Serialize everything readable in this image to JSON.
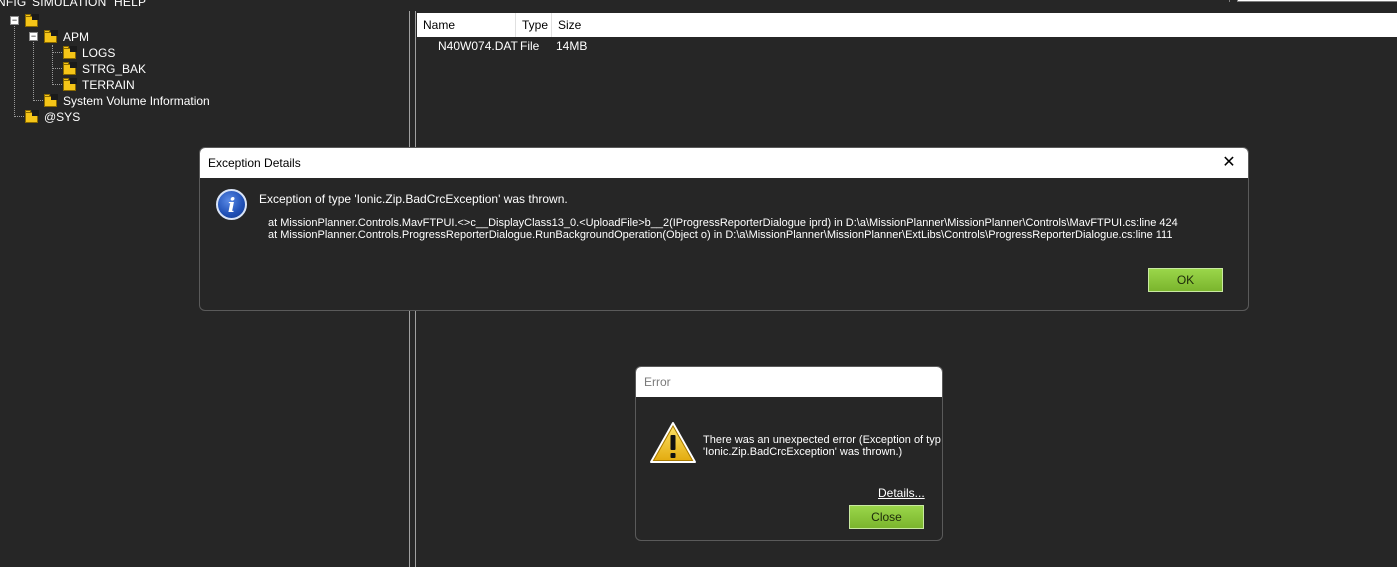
{
  "menubar": {
    "items": [
      "NFIG",
      "SIMULATION",
      "HELP"
    ]
  },
  "tree": {
    "nodes": {
      "root": "",
      "apm": "APM",
      "logs": "LOGS",
      "strg_bak": "STRG_BAK",
      "terrain": "TERRAIN",
      "svi": "System Volume Information",
      "sys": "@SYS"
    },
    "expander_minus": "−"
  },
  "file_list": {
    "columns": [
      "Name",
      "Type",
      "Size"
    ],
    "rows": [
      {
        "name": "N40W074.DAT",
        "type": "File",
        "size": "14MB"
      }
    ]
  },
  "exception_dialog": {
    "title": "Exception Details",
    "close_glyph": "✕",
    "icon_glyph": "i",
    "message": "Exception of type 'Ionic.Zip.BadCrcException' was thrown.",
    "trace_line1": "at MissionPlanner.Controls.MavFTPUI.<>c__DisplayClass13_0.<UploadFile>b__2(IProgressReporterDialogue iprd)  in  D:\\a\\MissionPlanner\\MissionPlanner\\Controls\\MavFTPUI.cs:line  424",
    "trace_line2": "at MissionPlanner.Controls.ProgressReporterDialogue.RunBackgroundOperation(Object o) in D:\\a\\MissionPlanner\\MissionPlanner\\ExtLibs\\Controls\\ProgressReporterDialogue.cs:line 111",
    "ok_label": "OK"
  },
  "error_dialog": {
    "title": "Error",
    "message_line1": "There was an unexpected error (Exception of typ",
    "message_line2": "'Ionic.Zip.BadCrcException' was thrown.)",
    "details_label": "Details...",
    "close_label": "Close"
  },
  "colors": {
    "background": "#262626",
    "button_green": "#8cc63f",
    "folder_yellow": "#f5c518",
    "info_blue": "#1f4fb5"
  }
}
